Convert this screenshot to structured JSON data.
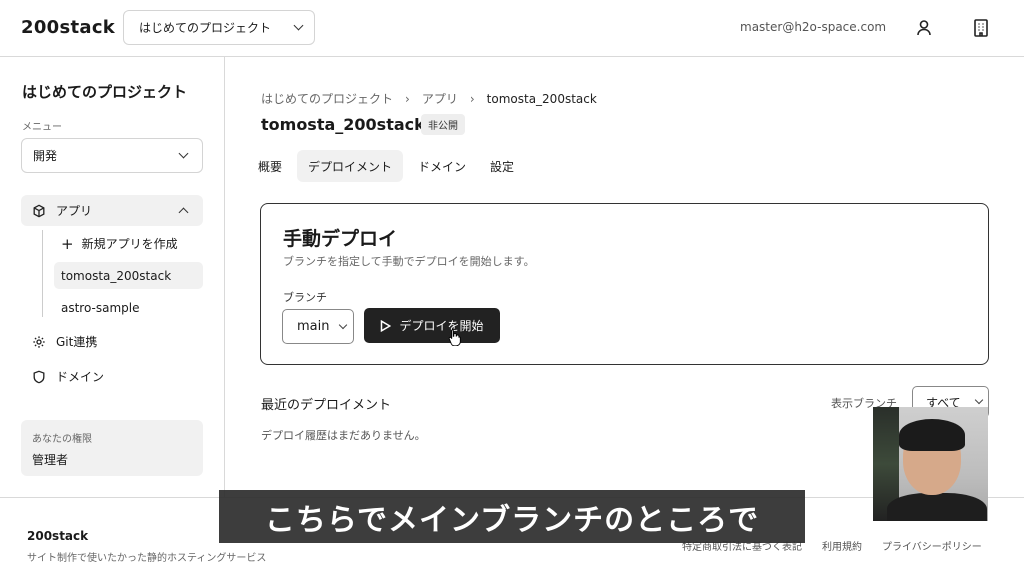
{
  "header": {
    "logo": "200stack",
    "project_select": "はじめてのプロジェクト",
    "email": "master@h2o-space.com",
    "icons": [
      "user-icon",
      "building-icon"
    ]
  },
  "sidebar": {
    "title": "はじめてのプロジェクト",
    "menu_label": "メニュー",
    "menu_select": "開発",
    "app_item": "アプリ",
    "sub_items": [
      {
        "label": "新規アプリを作成"
      },
      {
        "label": "tomosta_200stack"
      },
      {
        "label": "astro-sample"
      }
    ],
    "git_item": "Git連携",
    "domain_item": "ドメイン",
    "permission_label": "あなたの権限",
    "permission_value": "管理者"
  },
  "main": {
    "breadcrumb": [
      "はじめてのプロジェクト",
      "アプリ",
      "tomosta_200stack"
    ],
    "title": "tomosta_200stack",
    "badge": "非公開",
    "tabs": [
      "概要",
      "デプロイメント",
      "ドメイン",
      "設定"
    ],
    "card": {
      "title": "手動デプロイ",
      "description": "ブランチを指定して手動でデプロイを開始します。",
      "branch_label": "ブランチ",
      "branch_value": "main",
      "deploy_button": "デプロイを開始"
    },
    "recent_title": "最近のデプロイメント",
    "branch_filter_label": "表示ブランチ",
    "branch_filter_value": "すべて",
    "empty_message": "デプロイ履歴はまだありません。"
  },
  "footer": {
    "brand": "200stack",
    "tagline": "サイト制作で使いたかった静的ホスティングサービス",
    "links": [
      "特定商取引法に基づく表記",
      "利用規約",
      "プライバシーポリシー"
    ]
  },
  "caption": "こちらでメインブランチのところで"
}
